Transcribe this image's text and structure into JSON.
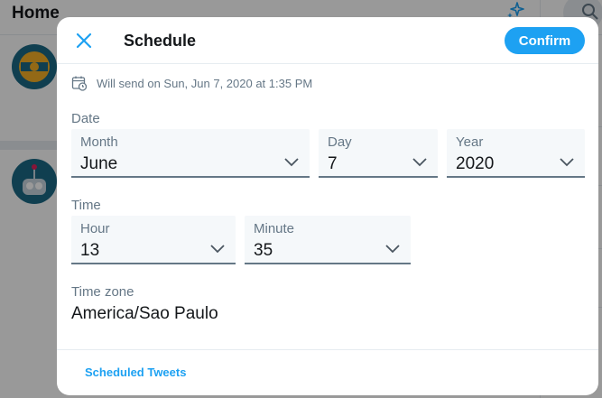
{
  "background": {
    "page_title": "Home"
  },
  "modal": {
    "title": "Schedule",
    "confirm_label": "Confirm",
    "send_info": "Will send on Sun, Jun 7, 2020 at 1:35 PM",
    "date_section": "Date",
    "time_section": "Time",
    "fields": {
      "month": {
        "label": "Month",
        "value": "June"
      },
      "day": {
        "label": "Day",
        "value": "7"
      },
      "year": {
        "label": "Year",
        "value": "2020"
      },
      "hour": {
        "label": "Hour",
        "value": "13"
      },
      "minute": {
        "label": "Minute",
        "value": "35"
      }
    },
    "timezone": {
      "label": "Time zone",
      "value": "America/Sao Paulo"
    },
    "footer_link": "Scheduled Tweets"
  },
  "colors": {
    "accent": "#1da1f2",
    "text_primary": "#14171a",
    "text_secondary": "#657786",
    "field_bg": "#f5f8fa"
  },
  "icons": {
    "close": "close-icon",
    "calendar": "calendar-clock-icon",
    "dropdown": "chevron-down-icon",
    "sparkle": "sparkle-icon",
    "search": "search-icon"
  }
}
